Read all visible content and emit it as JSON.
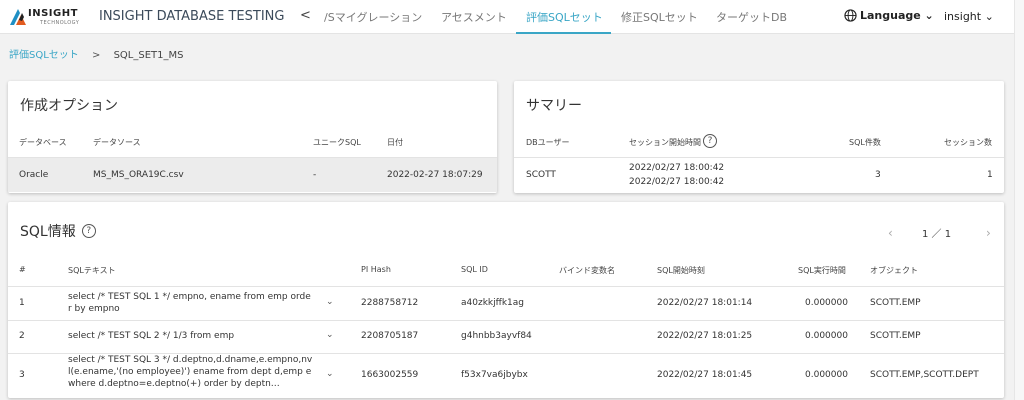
{
  "header": {
    "logo_text": "INSIGHT",
    "logo_sub": "TECHNOLOGY",
    "app_title": "INSIGHT DATABASE TESTING",
    "nav_prev": "<",
    "tabs": [
      "/Sマイグレーション",
      "アセスメント",
      "評価SQLセット",
      "修正SQLセット",
      "ターゲットDB"
    ],
    "active_tab": "評価SQLセット",
    "language": "Language ⌄",
    "user": "insight ⌄"
  },
  "breadcrumb": {
    "link": "評価SQLセット",
    "separator": ">",
    "current": "SQL_SET1_MS"
  },
  "options_card": {
    "title": "作成オプション",
    "headers": [
      "データベース",
      "データソース",
      "ユニークSQL",
      "日付"
    ],
    "row": [
      "Oracle",
      "MS_MS_ORA19C.csv",
      "-",
      "2022-02-27 18:07:29"
    ]
  },
  "summary_card": {
    "title": "サマリー",
    "headers": [
      "DBユーザー",
      "セッション開始時間",
      "SQL件数",
      "セッション数"
    ],
    "row": {
      "db_user": "SCOTT",
      "session_start_1": "2022/02/27 18:00:42",
      "session_start_2": "2022/02/27 18:00:42",
      "sql_count": "3",
      "session_count": "1"
    },
    "help": "?"
  },
  "sql_card": {
    "title": "SQL情報",
    "help": "?",
    "pager": {
      "prev": "‹",
      "text": "1 ／ 1",
      "next": "›"
    },
    "headers": [
      "#",
      "SQLテキスト",
      "PI Hash",
      "SQL ID",
      "バインド変数名",
      "SQL開始時刻",
      "SQL実行時間",
      "オブジェクト"
    ],
    "rows": [
      {
        "num": "1",
        "text": "select /* TEST SQL 1 */ empno, ename from emp order by empno",
        "pi_hash": "2288758712",
        "sql_id": "a40zkkjffk1ag",
        "bind": "",
        "start": "2022/02/27 18:01:14",
        "exec": "0.000000",
        "object": "SCOTT.EMP"
      },
      {
        "num": "2",
        "text": "select /* TEST SQL 2 */ 1/3 from emp",
        "pi_hash": "2208705187",
        "sql_id": "g4hnbb3ayvf84",
        "bind": "",
        "start": "2022/02/27 18:01:25",
        "exec": "0.000000",
        "object": "SCOTT.EMP"
      },
      {
        "num": "3",
        "text": "select /* TEST SQL 3 */ d.deptno,d.dname,e.empno,nvl(e.ename,'(no employee)') ename from dept d,emp e where d.deptno=e.deptno(+) order by deptn…",
        "pi_hash": "1663002559",
        "sql_id": "f53x7va6jbybx",
        "bind": "",
        "start": "2022/02/27 18:01:45",
        "exec": "0.000000",
        "object": "SCOTT.EMP,SCOTT.DEPT"
      }
    ],
    "expand_icon": "⌄"
  },
  "colors": {
    "accent": "#3aa6c6",
    "selected_row": "#ececec"
  }
}
